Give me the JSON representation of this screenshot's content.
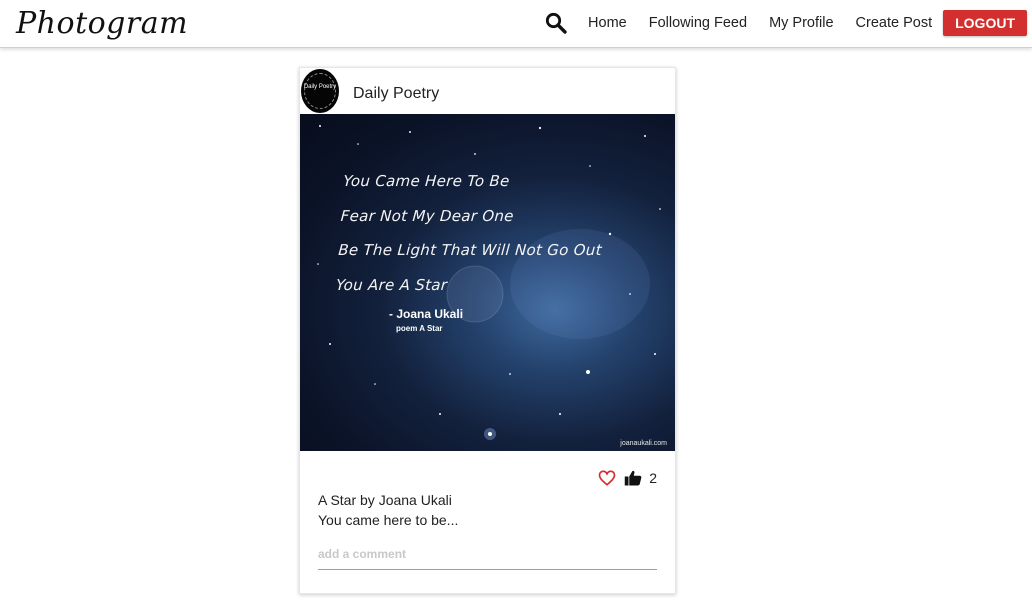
{
  "header": {
    "brand": "Photogram",
    "nav": {
      "home": "Home",
      "following_feed": "Following Feed",
      "my_profile": "My Profile",
      "create_post": "Create Post",
      "logout": "LOGOUT"
    },
    "icons": {
      "search": "search-icon"
    },
    "colors": {
      "logout_bg": "#d32f2f"
    }
  },
  "post": {
    "username": "Daily Poetry",
    "avatar_text": "Daily Poetry",
    "image": {
      "poem_lines": [
        "You Came Here To Be",
        "Fear Not My Dear One",
        "Be The Light That Will Not Go Out",
        "You Are A Star"
      ],
      "author": "- Joana Ukali",
      "source": "poem A Star",
      "watermark": "joanaukali.com"
    },
    "icons": {
      "heart": "heart-icon",
      "like": "thumbs-up-icon"
    },
    "likes": "2",
    "title": "A Star by Joana Ukali",
    "body": "You came here to be...",
    "comment_placeholder": "add a comment",
    "colors": {
      "heart": "#d32f2f"
    }
  }
}
